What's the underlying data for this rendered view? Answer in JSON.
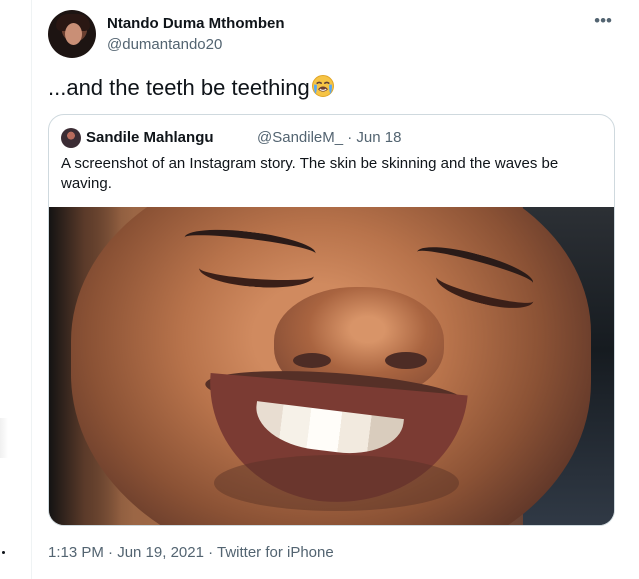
{
  "tweet": {
    "author_name": "Ntando Duma Mthomben",
    "author_handle": "@dumantando20",
    "text": "...and the teeth be teething",
    "emoji_icon": "crying-face-icon",
    "more_icon": "more-icon",
    "timestamp_line": "1:13 PM · Jun 19, 2021 · Twitter for iPhone"
  },
  "quote": {
    "author_name": "Sandile Mahlangu",
    "author_handle_date": "@SandileM_ · Jun 18",
    "text": "A screenshot of an Instagram story. The skin be skinning and the waves be waving."
  },
  "colors": {
    "text": "#0f1419",
    "muted": "#536471",
    "border": "#cfd9de",
    "background": "#ffffff"
  }
}
